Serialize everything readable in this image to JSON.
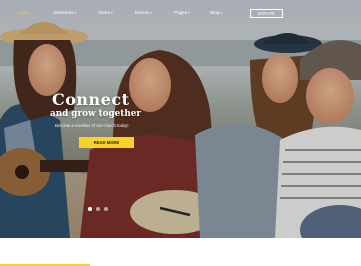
{
  "nav": {
    "items": [
      {
        "label": "Home",
        "active": true
      },
      {
        "label": "Ministries",
        "caret": "▾"
      },
      {
        "label": "About",
        "caret": "▾"
      },
      {
        "label": "Events",
        "caret": "▾"
      },
      {
        "label": "Pages",
        "caret": "▾"
      },
      {
        "label": "Blog",
        "caret": "▾"
      }
    ],
    "button_label": "DONATE"
  },
  "hero": {
    "title": "Connect",
    "subtitle": "and grow together",
    "tagline": "Become a member of our church today!",
    "cta_label": "READ MORE",
    "slides": [
      true,
      false,
      false
    ]
  },
  "colors": {
    "accent": "#f5d328",
    "text_on_dark": "#ffffff"
  }
}
